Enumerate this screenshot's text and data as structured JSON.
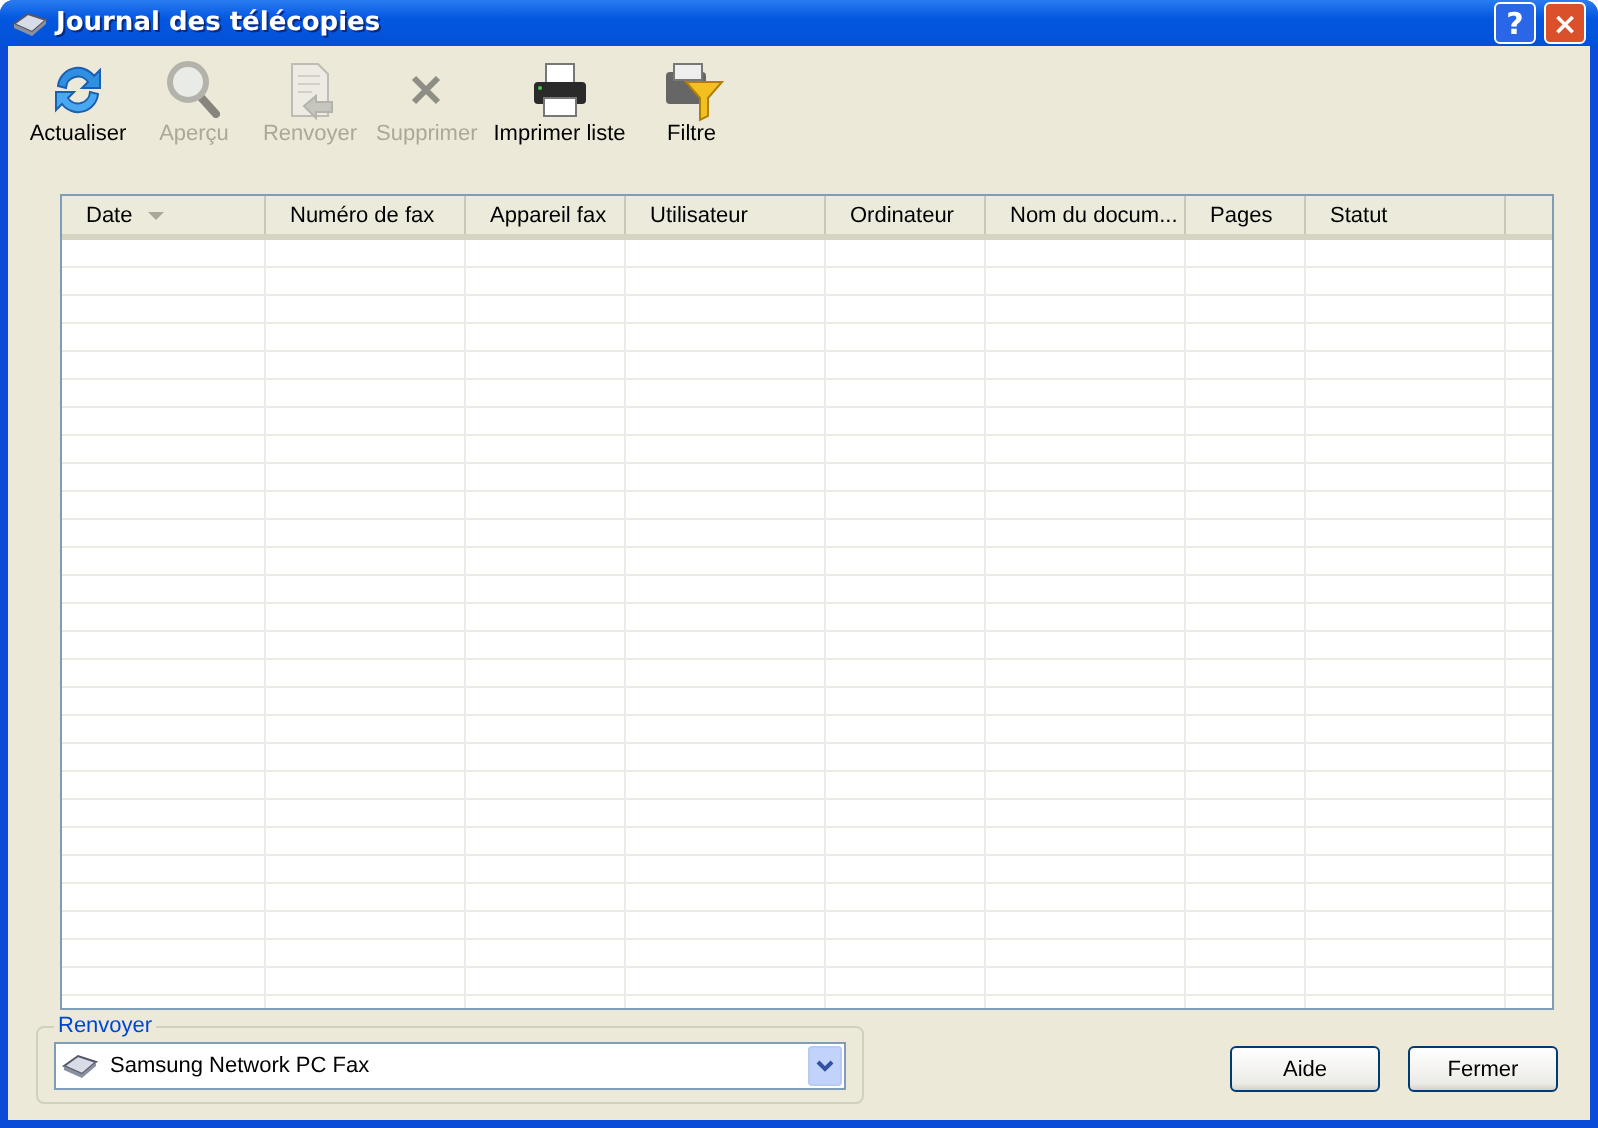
{
  "window": {
    "title": "Journal des télécopies",
    "help": "?",
    "close": "×"
  },
  "toolbar": [
    {
      "label": "Actualiser",
      "disabled": false
    },
    {
      "label": "Aperçu",
      "disabled": true
    },
    {
      "label": "Renvoyer",
      "disabled": true
    },
    {
      "label": "Supprimer",
      "disabled": true
    },
    {
      "label": "Imprimer liste",
      "disabled": false
    },
    {
      "label": "Filtre",
      "disabled": false
    }
  ],
  "table": {
    "columns": [
      {
        "label": "Date",
        "sorted": true
      },
      {
        "label": "Numéro de fax",
        "sorted": false
      },
      {
        "label": "Appareil fax",
        "sorted": false
      },
      {
        "label": "Utilisateur",
        "sorted": false
      },
      {
        "label": "Ordinateur",
        "sorted": false
      },
      {
        "label": "Nom du docum...",
        "sorted": false
      },
      {
        "label": "Pages",
        "sorted": false
      },
      {
        "label": "Statut",
        "sorted": false
      }
    ]
  },
  "resend": {
    "legend": "Renvoyer",
    "value": "Samsung Network PC Fax"
  },
  "buttons": [
    "Aide",
    "Fermer"
  ]
}
